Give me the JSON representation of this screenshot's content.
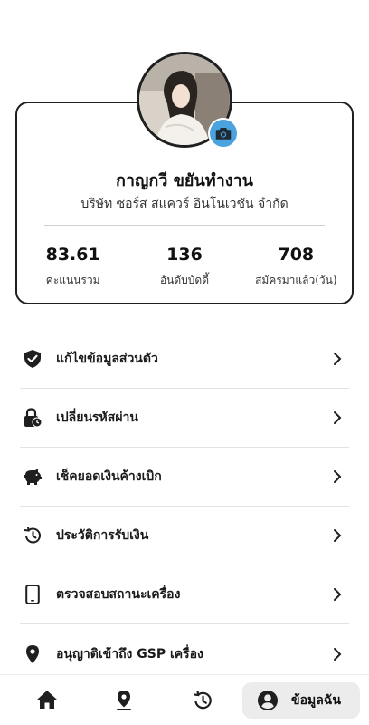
{
  "profile": {
    "name": "กาญกวี ขยันทำงาน",
    "company": "บริษัท ซอร์ส สแควร์ อินโนเวชัน จำกัด",
    "stats": [
      {
        "value": "83.61",
        "label": "คะแนนรวม"
      },
      {
        "value": "136",
        "label": "อันดับบัดดี้"
      },
      {
        "value": "708",
        "label": "สมัครมาแล้ว(วัน)"
      }
    ],
    "avatar_icon": "user-photo",
    "camera_icon": "camera-icon"
  },
  "menu": {
    "items": [
      {
        "label": "แก้ไขข้อมูลส่วนตัว",
        "icon": "shield-check-icon"
      },
      {
        "label": "เปลี่ยนรหัสผ่าน",
        "icon": "lock-clock-icon"
      },
      {
        "label": "เช็คยอดเงินค้างเบิก",
        "icon": "piggy-bank-icon"
      },
      {
        "label": "ประวัติการรับเงิน",
        "icon": "history-icon"
      },
      {
        "label": "ตรวจสอบสถานะเครื่อง",
        "icon": "smartphone-icon"
      },
      {
        "label": "อนุญาติเข้าถึง GSP เครื่อง",
        "icon": "location-pin-icon"
      }
    ]
  },
  "bottom_nav": {
    "home_icon": "home-icon",
    "location_icon": "location-icon",
    "history_icon": "history-icon",
    "me_label": "ข้อมูลฉัน"
  },
  "colors": {
    "accent": "#4aa3df",
    "text": "#1a1a1a",
    "nav_active_bg": "#ececec"
  }
}
